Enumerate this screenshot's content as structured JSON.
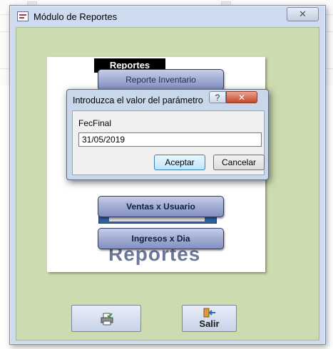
{
  "main_window": {
    "title": "Módulo de Reportes",
    "close_symbol": "✕"
  },
  "report_panel": {
    "heading": "Reportes",
    "buttons": [
      {
        "label": "Reporte Inventario"
      },
      {
        "label": "Ventas x Usuario"
      },
      {
        "label": "Ingresos x Dia"
      }
    ],
    "logo_text": "Reportes"
  },
  "command_buttons": {
    "print_icon": "print-icon",
    "exit_icon": "exit-door-icon",
    "exit_label": "Salir"
  },
  "parameter_dialog": {
    "title": "Introduzca el valor del parámetro",
    "help_symbol": "?",
    "close_symbol": "✕",
    "field_label": "FecFinal",
    "field_value": "31/05/2019",
    "ok_label": "Aceptar",
    "cancel_label": "Cancelar"
  },
  "colors": {
    "window_client_green": "#cddbb0",
    "menu_button_blue": "#9ea9d2",
    "dialog_frame": "#c9d7ea",
    "close_red": "#c5472a"
  }
}
